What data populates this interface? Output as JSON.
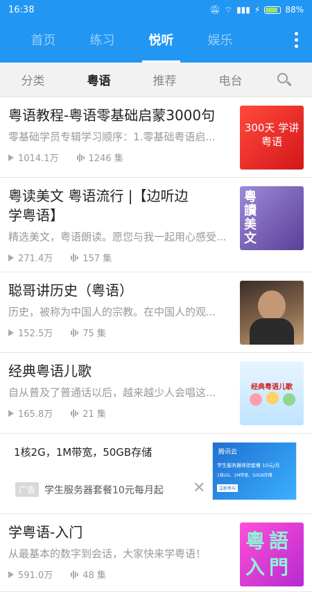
{
  "status": {
    "time": "16:38",
    "battery": "88%"
  },
  "nav": {
    "tabs": [
      "首页",
      "练习",
      "悦听",
      "娱乐"
    ],
    "active": 2
  },
  "subnav": {
    "tabs": [
      "分类",
      "粤语",
      "推荐",
      "电台"
    ],
    "active": 1
  },
  "items": [
    {
      "title": "粤语教程-粤语零基础启蒙3000句",
      "desc": "零基础学员专辑学习顺序：1.零基础粤语启...",
      "plays": "1014.1万",
      "episodes": "1246 集",
      "thumb_text": "300天 学讲粤语",
      "thumb_color": "#e9231f"
    },
    {
      "title": "粤读美文 粤语流行 |【边听边学粤语】",
      "desc": "精选美文，粤语朗读。愿您与我一起用心感受...",
      "plays": "271.4万",
      "episodes": "157 集",
      "thumb_text": "粵讀美文",
      "thumb_color": "#6f5aa8"
    },
    {
      "title": "聪哥讲历史（粤语）",
      "desc": "历史，被称为中国人的宗教。在中国人的观...",
      "plays": "152.5万",
      "episodes": "75 集",
      "thumb_text": "",
      "thumb_color": "#5a4638"
    },
    {
      "title": "经典粤语儿歌",
      "desc": "自从普及了普通话以后，越来越少人会唱这...",
      "plays": "165.8万",
      "episodes": "21 集",
      "thumb_text": "经典粤语儿歌",
      "thumb_color": "#dff0ff"
    }
  ],
  "ad": {
    "title": "1核2G，1M带宽，50GB存储",
    "tag": "广告",
    "desc": "学生服务器套餐10元每月起",
    "close": "✕",
    "thumb_brand": "腾讯云",
    "thumb_line1": "学生服务器体验套餐 10元/月",
    "thumb_line2": "1核2G、1M带宽、50GB存储",
    "thumb_button": "立即参与"
  },
  "last_item": {
    "title": "学粤语-入门",
    "desc": "从最基本的数字到会话，大家快来学粤语！",
    "plays": "591.0万",
    "episodes": "48 集",
    "thumb_text": "粵語入門",
    "thumb_color": "#e23bc4"
  }
}
